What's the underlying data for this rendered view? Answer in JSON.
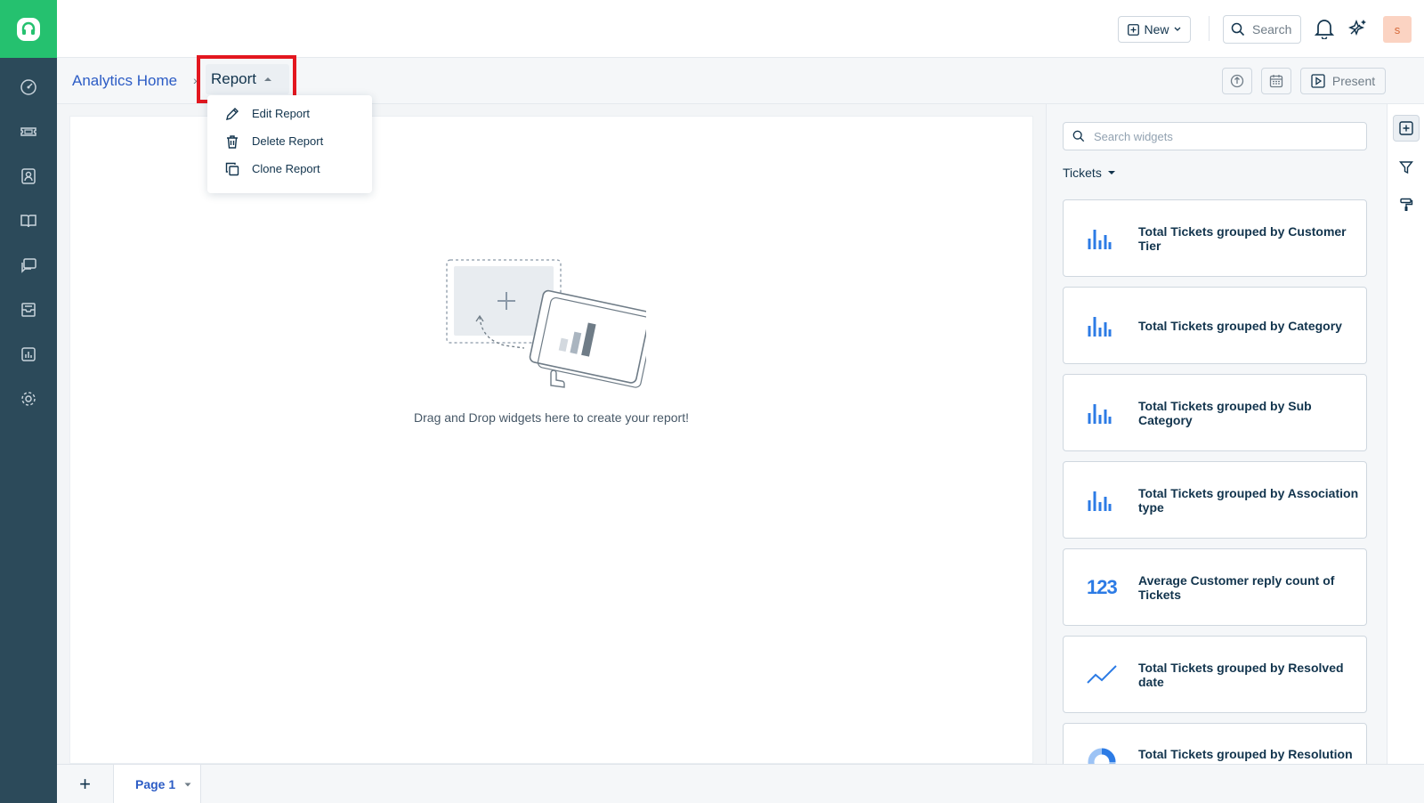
{
  "header": {
    "new_label": "New",
    "search_label": "Search",
    "avatar_initial": "s"
  },
  "breadcrumb": {
    "home": "Analytics Home",
    "separator": "›",
    "current": "Report"
  },
  "toolbar": {
    "present_label": "Present"
  },
  "report_menu": {
    "items": [
      {
        "label": "Edit Report",
        "icon": "pencil-icon"
      },
      {
        "label": "Delete Report",
        "icon": "trash-icon"
      },
      {
        "label": "Clone Report",
        "icon": "clone-icon"
      }
    ]
  },
  "canvas": {
    "empty_message": "Drag and Drop widgets here to create your report!"
  },
  "widgets_panel": {
    "search_placeholder": "Search widgets",
    "category": "Tickets",
    "cards": [
      {
        "label": "Total Tickets grouped by Customer Tier",
        "icon": "bar-chart-icon"
      },
      {
        "label": "Total Tickets grouped by Category",
        "icon": "bar-chart-icon"
      },
      {
        "label": "Total Tickets grouped by Sub Category",
        "icon": "bar-chart-icon"
      },
      {
        "label": "Total Tickets grouped by Association type",
        "icon": "bar-chart-icon"
      },
      {
        "label": "Average Customer reply count of Tickets",
        "icon": "number-icon",
        "icon_text": "123"
      },
      {
        "label": "Total Tickets grouped by Resolved date",
        "icon": "line-chart-icon"
      },
      {
        "label": "Total Tickets grouped by Resolution",
        "icon": "donut-chart-icon"
      }
    ]
  },
  "footer": {
    "add_page": "+",
    "page_tab": "Page 1"
  },
  "colors": {
    "sidebar": "#2c4a5a",
    "brand_green": "#25c16f",
    "link_blue": "#2c5cc5",
    "highlight_red": "#e3171f",
    "chart_blue": "#2c7be5"
  }
}
